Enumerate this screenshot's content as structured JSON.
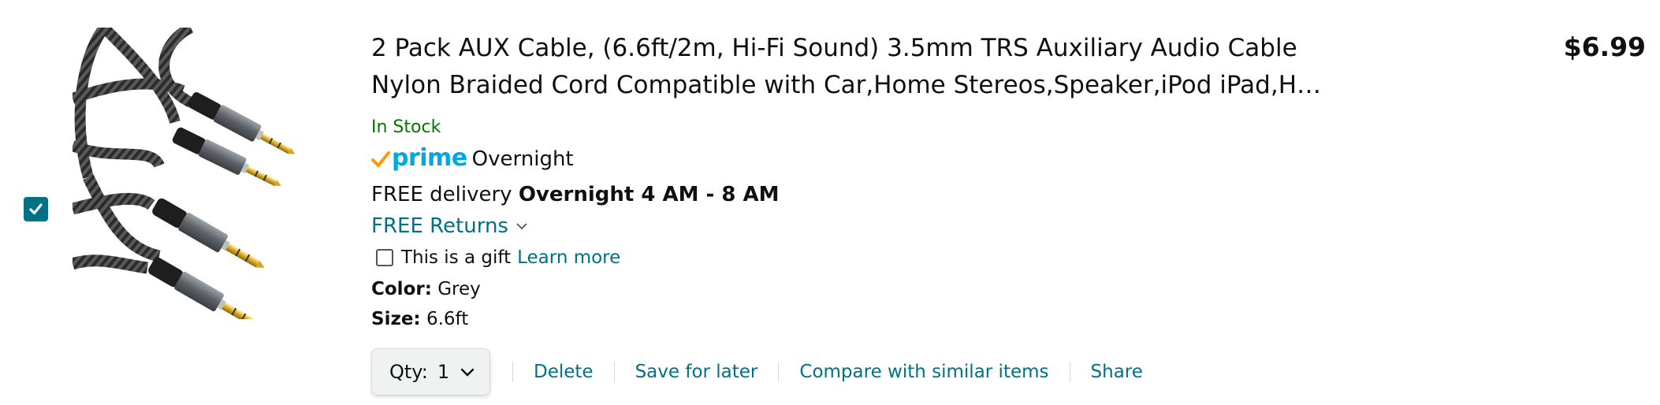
{
  "product": {
    "title": "2 Pack AUX Cable, (6.6ft/2m, Hi-Fi Sound) 3.5mm TRS Auxiliary Audio Cable Nylon Braided Cord Compatible with Car,Home Stereos,Speaker,iPod iPad,H…",
    "title_line1": "2 Pack AUX Cable, (6.6ft/2m, Hi-Fi Sound) 3.5mm TRS Auxiliary Audio Cable",
    "title_line2": "Nylon Braided Cord Compatible with Car,Home Stereos,Speaker,iPod iPad,H…",
    "price": "$6.99",
    "stock_status": "In Stock",
    "image_icon": "aux-cable-product-image",
    "selected": true
  },
  "prime": {
    "logo_text": "prime",
    "speed": "Overnight"
  },
  "delivery": {
    "prefix": "FREE delivery",
    "window": "Overnight 4 AM - 8 AM"
  },
  "returns": {
    "label": "FREE Returns",
    "icon": "chevron-down-icon"
  },
  "gift": {
    "label": "This is a gift",
    "link": "Learn more",
    "checked": false
  },
  "attributes": {
    "color_label": "Color:",
    "color_value": "Grey",
    "size_label": "Size:",
    "size_value": "6.6ft"
  },
  "actions": {
    "qty_label": "Qty:",
    "qty_value": "1",
    "delete": "Delete",
    "save_for_later": "Save for later",
    "compare": "Compare with similar items",
    "share": "Share"
  },
  "colors": {
    "link": "#007185",
    "in_stock": "#007600",
    "prime_blue": "#00a8e1",
    "prime_check": "#ff9900",
    "text": "#0f1111"
  }
}
